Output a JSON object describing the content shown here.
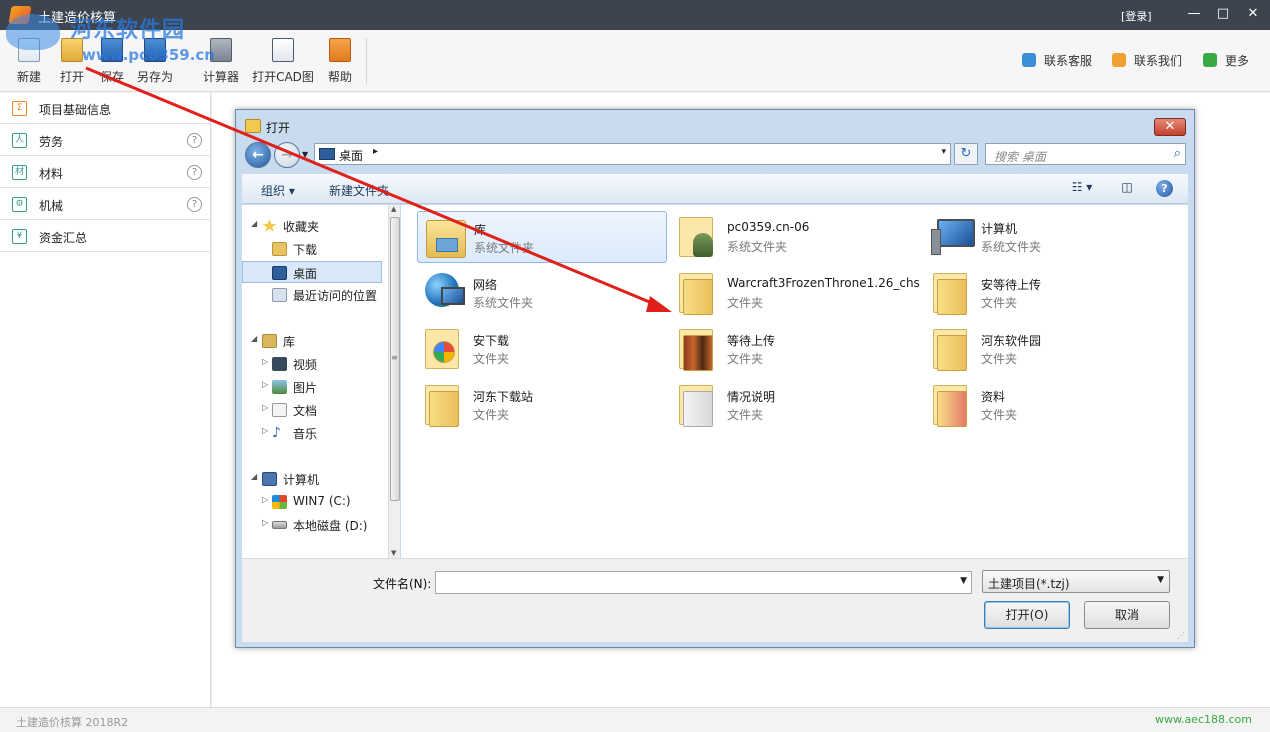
{
  "app": {
    "title": "土建造价核算",
    "login": "[登录]",
    "win_min": "—",
    "win_max": "□",
    "win_close": "✕"
  },
  "watermark": {
    "line1": "河东软件园",
    "line2": "www.pc0359.cn"
  },
  "toolbar": {
    "items": [
      {
        "label": "新建",
        "icon": "new-file-icon"
      },
      {
        "label": "打开",
        "icon": "open-folder-icon"
      },
      {
        "label": "保存",
        "icon": "save-icon"
      },
      {
        "label": "另存为",
        "icon": "save-as-icon"
      },
      {
        "label": "计算器",
        "icon": "calculator-icon"
      },
      {
        "label": "打开CAD图",
        "icon": "dwg-file-icon"
      },
      {
        "label": "帮助",
        "icon": "help-book-icon"
      }
    ],
    "right_links": [
      {
        "label": "联系客服",
        "icon": "customer-service-icon",
        "color": "#3a8fd8"
      },
      {
        "label": "联系我们",
        "icon": "mail-icon",
        "color": "#f0a030"
      },
      {
        "label": "更多",
        "icon": "more-icon",
        "color": "#3aa845"
      }
    ]
  },
  "sidebar": {
    "items": [
      {
        "label": "项目基础信息",
        "icon_glyph": "Σ",
        "help": ""
      },
      {
        "label": "劳务",
        "icon_glyph": "人",
        "help": "?"
      },
      {
        "label": "材料",
        "icon_glyph": "材",
        "help": "?"
      },
      {
        "label": "机械",
        "icon_glyph": "⚙",
        "help": "?"
      },
      {
        "label": "资金汇总",
        "icon_glyph": "¥",
        "help": ""
      }
    ]
  },
  "status": {
    "version": "土建造价核算 2018R2",
    "url": "www.aec188.com"
  },
  "dialog": {
    "title": "打开",
    "close": "✕",
    "address": {
      "location": "桌面",
      "arrow": "▸",
      "drop": "▾"
    },
    "refresh": "↻",
    "search_placeholder": "搜索 桌面",
    "search_glyph": "⌕",
    "cmdbar": {
      "organize": "组织 ▾",
      "new_folder": "新建文件夹",
      "help": "?",
      "view_glyph": "☷ ▾",
      "pane_glyph": "◫"
    },
    "tree": {
      "favorites": "收藏夹",
      "downloads": "下载",
      "desktop": "桌面",
      "recent": "最近访问的位置",
      "libraries": "库",
      "videos": "视频",
      "pictures": "图片",
      "documents": "文档",
      "music": "音乐",
      "computer": "计算机",
      "drive_c": "WIN7 (C:)",
      "drive_d": "本地磁盘 (D:)"
    },
    "files": [
      {
        "name": "库",
        "type": "系统文件夹",
        "icon": "library-icon"
      },
      {
        "name": "pc0359.cn-06",
        "type": "系统文件夹",
        "icon": "user-folder-icon"
      },
      {
        "name": "计算机",
        "type": "系统文件夹",
        "icon": "computer-icon"
      },
      {
        "name": "网络",
        "type": "系统文件夹",
        "icon": "network-icon"
      },
      {
        "name": "Warcraft3FrozenThrone1.26_chs",
        "type": "文件夹",
        "icon": "folder-icon"
      },
      {
        "name": "安等待上传",
        "type": "文件夹",
        "icon": "folder-icon"
      },
      {
        "name": "安下载",
        "type": "文件夹",
        "icon": "folder-icon"
      },
      {
        "name": "等待上传",
        "type": "文件夹",
        "icon": "folder-icon"
      },
      {
        "name": "河东软件园",
        "type": "文件夹",
        "icon": "folder-icon"
      },
      {
        "name": "河东下载站",
        "type": "文件夹",
        "icon": "folder-icon"
      },
      {
        "name": "情况说明",
        "type": "文件夹",
        "icon": "folder-icon"
      },
      {
        "name": "资料",
        "type": "文件夹",
        "icon": "folder-icon"
      }
    ],
    "filename_label": "文件名(N):",
    "filename_value": "",
    "filetype": "土建项目(*.tzj)",
    "open_button": "打开(O)",
    "cancel_button": "取消"
  }
}
